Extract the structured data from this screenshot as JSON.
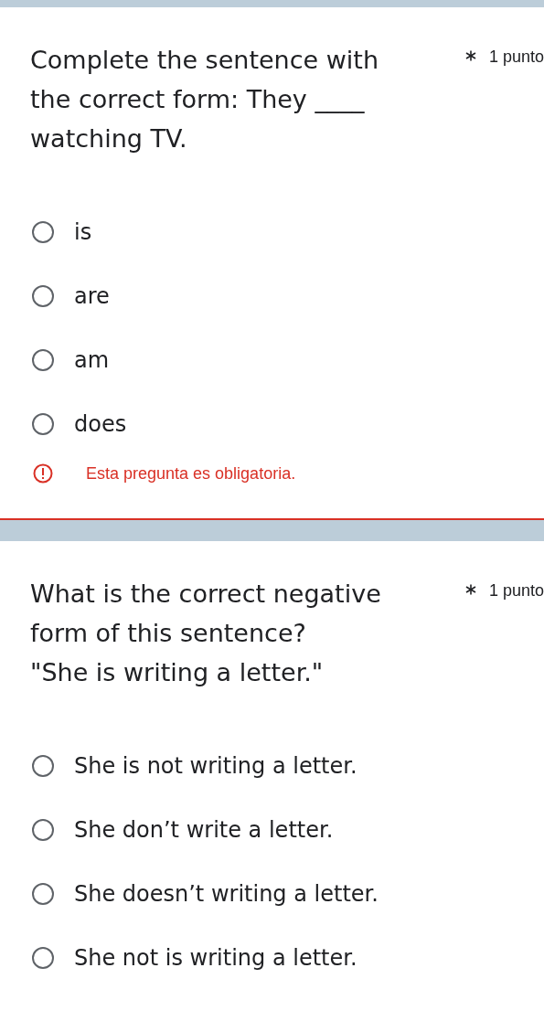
{
  "questions": [
    {
      "title": "Complete the sentence with the correct form: They ____ watching TV.",
      "required": true,
      "points": "1 punto",
      "options": [
        {
          "label": "is",
          "selected": false
        },
        {
          "label": "are",
          "selected": false
        },
        {
          "label": "am",
          "selected": false
        },
        {
          "label": "does",
          "selected": false
        }
      ],
      "error": "Esta pregunta es obligatoria."
    },
    {
      "title": "What is the correct negative form of this sentence?\n\"She is writing a letter.\"",
      "required": true,
      "points": "1 punto",
      "options": [
        {
          "label": "She is not writing a letter.",
          "selected": false
        },
        {
          "label": "She don’t write a letter.",
          "selected": false
        },
        {
          "label": "She doesn’t writing a letter.",
          "selected": false
        },
        {
          "label": "She not is writing a letter.",
          "selected": false
        }
      ]
    }
  ]
}
